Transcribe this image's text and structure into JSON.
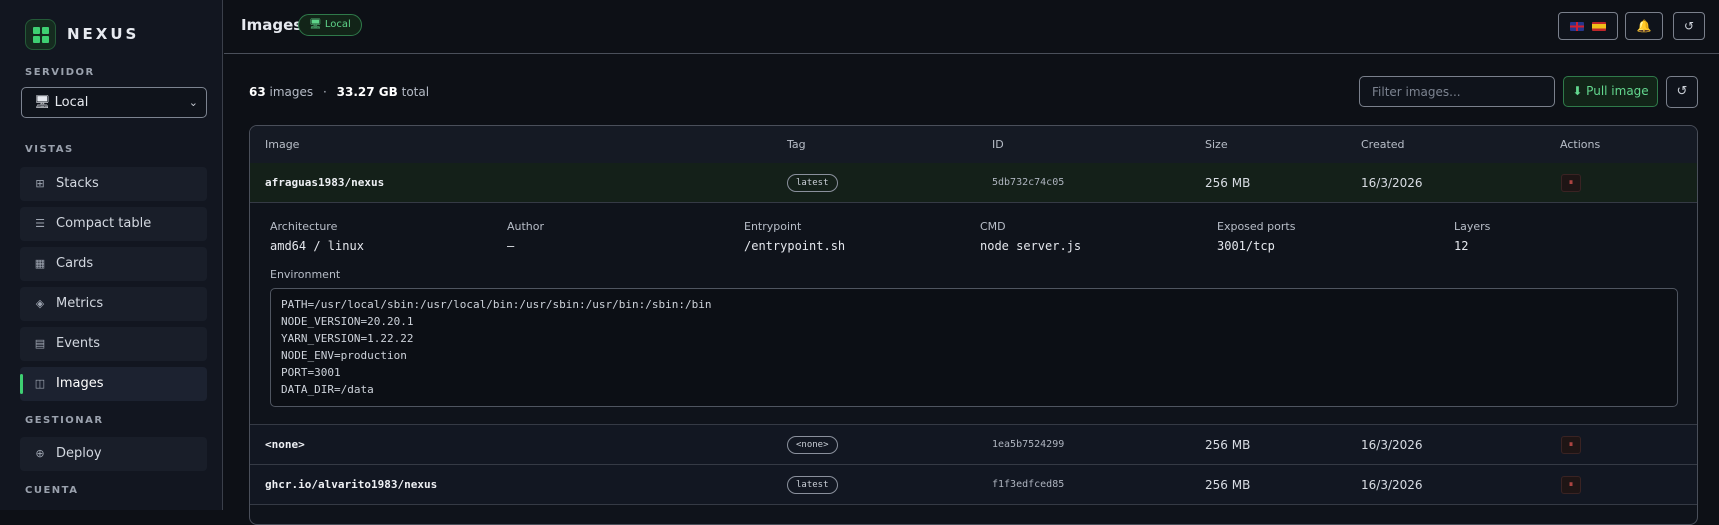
{
  "app": {
    "name": "NEXUS"
  },
  "sidebar": {
    "server_label": "SERVIDOR",
    "server_value": "Local",
    "server_icon": "server-icon",
    "views_label": "VISTAS",
    "items": [
      {
        "label": "Stacks",
        "icon": "grid-icon"
      },
      {
        "label": "Compact table",
        "icon": "list-icon"
      },
      {
        "label": "Cards",
        "icon": "cards-icon"
      },
      {
        "label": "Metrics",
        "icon": "diamond-icon"
      },
      {
        "label": "Events",
        "icon": "events-icon"
      },
      {
        "label": "Images",
        "icon": "images-icon",
        "active": true
      }
    ],
    "manage_label": "GESTIONAR",
    "manage_items": [
      {
        "label": "Deploy",
        "icon": "target-icon"
      }
    ],
    "account_label": "CUENTA"
  },
  "header": {
    "title": "Images",
    "badge": "Local",
    "refresh_glyph": "↺"
  },
  "summary": {
    "count": "63",
    "count_label": "images",
    "separator": "·",
    "size": "33.27 GB",
    "size_label": "total"
  },
  "toolbar": {
    "filter_placeholder": "Filter images...",
    "pull_label": "⬇ Pull image",
    "refresh_glyph": "↺"
  },
  "table": {
    "columns": [
      "Image",
      "Tag",
      "ID",
      "Size",
      "Created",
      "Actions"
    ],
    "rows": [
      {
        "image": "afraguas1983/nexus",
        "tag": "latest",
        "id": "5db732c74c05",
        "size": "256 MB",
        "created": "16/3/2026"
      },
      {
        "image": "<none>",
        "tag": "<none>",
        "id": "1ea5b7524299",
        "size": "256 MB",
        "created": "16/3/2026"
      },
      {
        "image": "ghcr.io/alvarito1983/nexus",
        "tag": "latest",
        "id": "f1f3edfced85",
        "size": "256 MB",
        "created": "16/3/2026"
      }
    ],
    "delete_glyph": "⏸"
  },
  "detail": {
    "architecture_label": "Architecture",
    "architecture": "amd64 / linux",
    "author_label": "Author",
    "author": "—",
    "entrypoint_label": "Entrypoint",
    "entrypoint": "/entrypoint.sh",
    "cmd_label": "CMD",
    "cmd": "node server.js",
    "ports_label": "Exposed ports",
    "ports": "3001/tcp",
    "layers_label": "Layers",
    "layers": "12",
    "environment_label": "Environment",
    "environment": [
      "PATH=/usr/local/sbin:/usr/local/bin:/usr/sbin:/usr/bin:/sbin:/bin",
      "NODE_VERSION=20.20.1",
      "YARN_VERSION=1.22.22",
      "NODE_ENV=production",
      "PORT=3001",
      "DATA_DIR=/data"
    ]
  },
  "colors": {
    "accent": "#3ecf72",
    "danger": "#d9534f",
    "background": "#0d1016"
  }
}
